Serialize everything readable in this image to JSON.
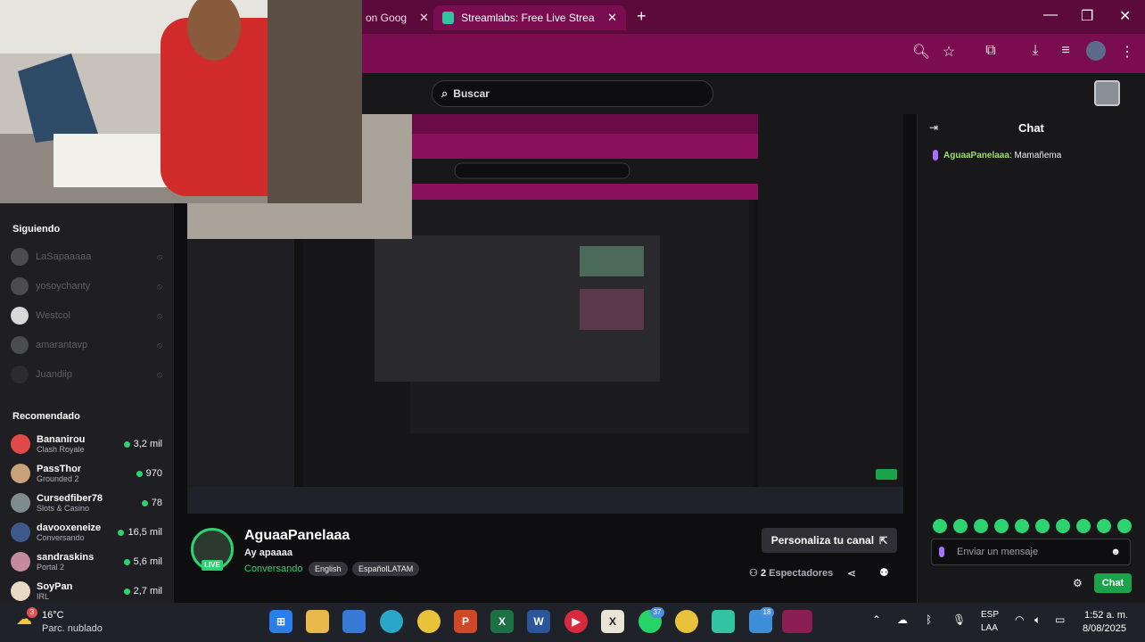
{
  "browser": {
    "tabs": [
      {
        "label": "on Goog",
        "active": false
      },
      {
        "label": "Streamlabs: Free Live Streaming",
        "active": true
      }
    ],
    "new_tab": "+",
    "window_controls": [
      "—",
      "❐",
      "✕"
    ]
  },
  "topnav": {
    "search_placeholder": "Buscar"
  },
  "sidebar": {
    "following_header": "Siguiendo",
    "following": [
      {
        "name": "LaSapaaaaa"
      },
      {
        "name": "yosoychanty"
      },
      {
        "name": "Westcol"
      },
      {
        "name": "amarantavp"
      },
      {
        "name": "Juandiip"
      }
    ],
    "recommended_header": "Recomendado",
    "recommended": [
      {
        "name": "Bananirou",
        "category": "Clash Royale",
        "viewers": "3,2 mil",
        "color": "#e24a4a"
      },
      {
        "name": "PassThor",
        "category": "Grounded 2",
        "viewers": "970",
        "color": "#c9a27a"
      },
      {
        "name": "Cursedfiber78",
        "category": "Slots & Casino",
        "viewers": "78",
        "color": "#7f8c8d"
      },
      {
        "name": "davooxeneize",
        "category": "Conversando",
        "viewers": "16,5 mil",
        "color": "#3d5a8a"
      },
      {
        "name": "sandraskins",
        "category": "Portal 2",
        "viewers": "5,6 mil",
        "color": "#c48b9f"
      },
      {
        "name": "SoyPan",
        "category": "IRL",
        "viewers": "2,7 mil",
        "color": "#e8d9c4"
      }
    ]
  },
  "channel": {
    "name": "AguaaPanelaaa",
    "live_badge": "LIVE",
    "title": "Ay apaaaa",
    "category": "Conversando",
    "tags": [
      "English",
      "EspañolLATAM"
    ],
    "personaliza_label": "Personaliza tu canal",
    "viewers_count": "2",
    "viewers_label": "Espectadores"
  },
  "chat": {
    "title": "Chat",
    "messages": [
      {
        "user": "AguaaPanelaaa",
        "text": ": Mamañema"
      }
    ],
    "input_placeholder": "Enviar un mensaje",
    "send_label": "Chat"
  },
  "taskbar": {
    "weather_badge": "3",
    "temperature": "16°C",
    "weather": "Parc. nublado",
    "apps": [
      {
        "name": "windows-start-icon",
        "label": "",
        "color": "#2b7de9"
      },
      {
        "name": "file-explorer-icon",
        "label": "",
        "color": "#e8b84a"
      },
      {
        "name": "store-icon",
        "label": "",
        "color": "#3a78d6"
      },
      {
        "name": "edge-icon",
        "label": "",
        "color": "#2aa6c9"
      },
      {
        "name": "chrome-icon",
        "label": "",
        "color": "#e8c33a"
      },
      {
        "name": "powerpoint-icon",
        "label": "P",
        "color": "#d24726"
      },
      {
        "name": "excel-icon",
        "label": "X",
        "color": "#1d7044"
      },
      {
        "name": "word-icon",
        "label": "W",
        "color": "#2b579a"
      },
      {
        "name": "media-player-icon",
        "label": "▶",
        "color": "#d92a3d"
      },
      {
        "name": "calculator-icon",
        "label": "X",
        "color": "#e9e4d6"
      },
      {
        "name": "whatsapp-icon",
        "label": "",
        "color": "#25d366"
      },
      {
        "name": "chrome-active-icon",
        "label": "",
        "color": "#e8c33a"
      },
      {
        "name": "streamlabs-icon",
        "label": "",
        "color": "#31c3a2"
      },
      {
        "name": "twitter-app-icon",
        "label": "",
        "color": "#3b8fd8"
      },
      {
        "name": "camera-app-icon",
        "label": "",
        "color": "#2a8dd3"
      }
    ],
    "badges": {
      "whatsapp": "37",
      "twitter": "18"
    },
    "lang_line1": "ESP",
    "lang_line2": "LAA",
    "time": "1:52 a. m.",
    "date": "8/08/2025"
  }
}
